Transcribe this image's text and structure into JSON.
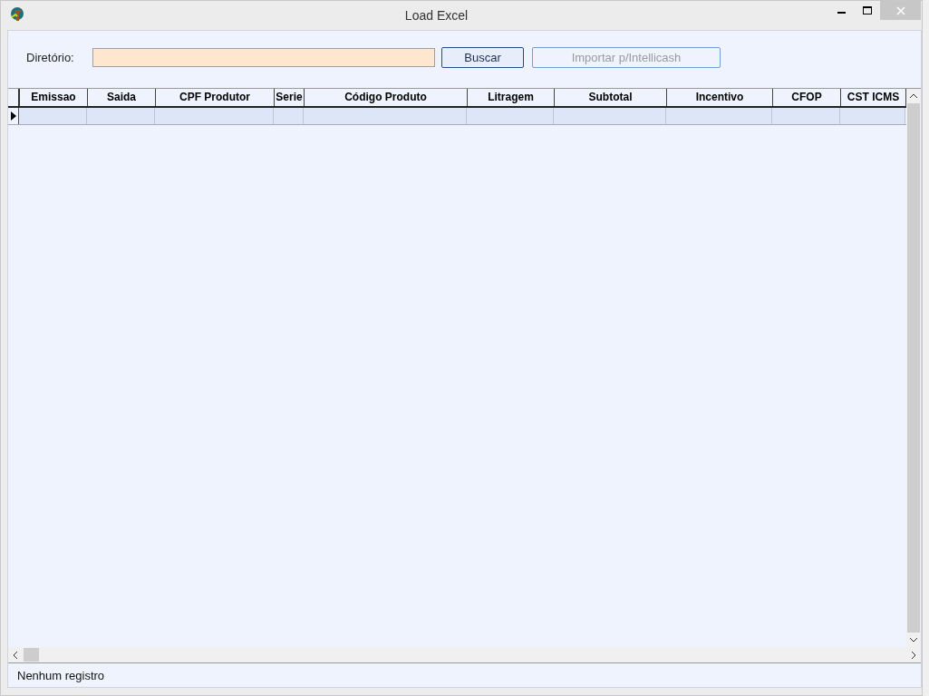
{
  "window": {
    "title": "Load Excel"
  },
  "toolbar": {
    "directory_label": "Diretório:",
    "buttons": [
      {
        "label": "Buscar",
        "disabled": false
      },
      {
        "label": "Importar p/Intellicash",
        "disabled": true
      }
    ]
  },
  "table": {
    "columns": [
      "Emissao",
      "Saida",
      "CPF Produtor",
      "Serie",
      "Código Produto",
      "Litragem",
      "Subtotal",
      "Incentivo",
      "CFOP",
      "CST ICMS"
    ],
    "rows": [
      {
        "selected": true
      }
    ]
  },
  "status_bar": {
    "text": "Nenhum registro"
  }
}
